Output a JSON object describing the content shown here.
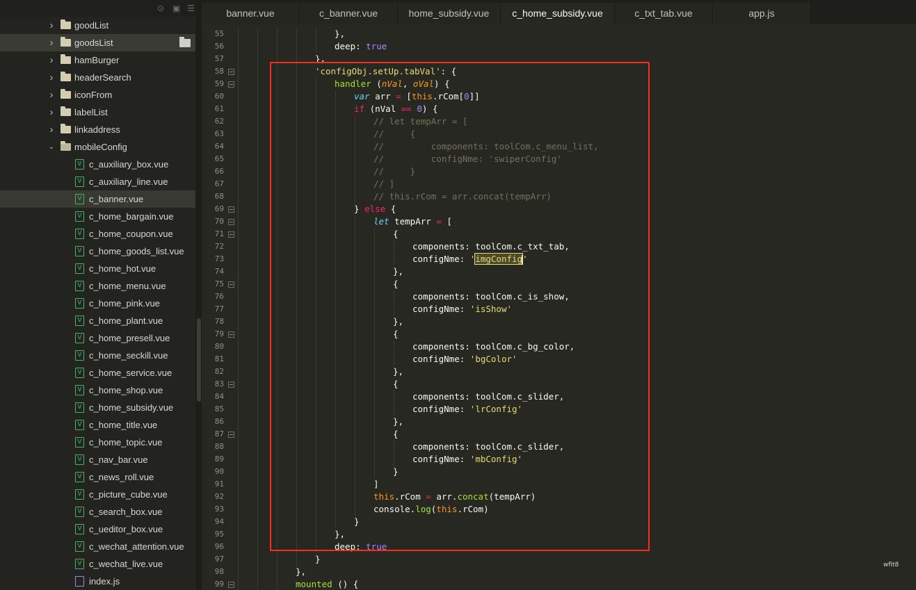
{
  "sidebar": {
    "items": [
      {
        "label": "goodList",
        "type": "folder",
        "level": 1,
        "expanded": false
      },
      {
        "label": "goodsList",
        "type": "folder",
        "level": 1,
        "expanded": false,
        "selected": true
      },
      {
        "label": "hamBurger",
        "type": "folder",
        "level": 1,
        "expanded": false
      },
      {
        "label": "headerSearch",
        "type": "folder",
        "level": 1,
        "expanded": false
      },
      {
        "label": "iconFrom",
        "type": "folder",
        "level": 1,
        "expanded": false
      },
      {
        "label": "labelList",
        "type": "folder",
        "level": 1,
        "expanded": false
      },
      {
        "label": "linkaddress",
        "type": "folder",
        "level": 1,
        "expanded": false
      },
      {
        "label": "mobileConfig",
        "type": "folder",
        "level": 1,
        "expanded": true
      },
      {
        "label": "c_auxiliary_box.vue",
        "type": "vue",
        "level": 2
      },
      {
        "label": "c_auxiliary_line.vue",
        "type": "vue",
        "level": 2
      },
      {
        "label": "c_banner.vue",
        "type": "vue",
        "level": 2,
        "active": true
      },
      {
        "label": "c_home_bargain.vue",
        "type": "vue",
        "level": 2
      },
      {
        "label": "c_home_coupon.vue",
        "type": "vue",
        "level": 2
      },
      {
        "label": "c_home_goods_list.vue",
        "type": "vue",
        "level": 2
      },
      {
        "label": "c_home_hot.vue",
        "type": "vue",
        "level": 2
      },
      {
        "label": "c_home_menu.vue",
        "type": "vue",
        "level": 2
      },
      {
        "label": "c_home_pink.vue",
        "type": "vue",
        "level": 2
      },
      {
        "label": "c_home_plant.vue",
        "type": "vue",
        "level": 2
      },
      {
        "label": "c_home_presell.vue",
        "type": "vue",
        "level": 2
      },
      {
        "label": "c_home_seckill.vue",
        "type": "vue",
        "level": 2
      },
      {
        "label": "c_home_service.vue",
        "type": "vue",
        "level": 2
      },
      {
        "label": "c_home_shop.vue",
        "type": "vue",
        "level": 2
      },
      {
        "label": "c_home_subsidy.vue",
        "type": "vue",
        "level": 2
      },
      {
        "label": "c_home_title.vue",
        "type": "vue",
        "level": 2
      },
      {
        "label": "c_home_topic.vue",
        "type": "vue",
        "level": 2
      },
      {
        "label": "c_nav_bar.vue",
        "type": "vue",
        "level": 2
      },
      {
        "label": "c_news_roll.vue",
        "type": "vue",
        "level": 2
      },
      {
        "label": "c_picture_cube.vue",
        "type": "vue",
        "level": 2
      },
      {
        "label": "c_search_box.vue",
        "type": "vue",
        "level": 2
      },
      {
        "label": "c_ueditor_box.vue",
        "type": "vue",
        "level": 2
      },
      {
        "label": "c_wechat_attention.vue",
        "type": "vue",
        "level": 2
      },
      {
        "label": "c_wechat_live.vue",
        "type": "vue",
        "level": 2
      },
      {
        "label": "index.js",
        "type": "js",
        "level": 2
      }
    ]
  },
  "tabs": [
    {
      "label": "banner.vue",
      "active": false
    },
    {
      "label": "c_banner.vue",
      "active": false
    },
    {
      "label": "home_subsidy.vue",
      "active": false
    },
    {
      "label": "c_home_subsidy.vue",
      "active": true
    },
    {
      "label": "c_txt_tab.vue",
      "active": false
    },
    {
      "label": "app.js",
      "active": false
    }
  ],
  "editor": {
    "lines": [
      {
        "n": "55",
        "fold": false,
        "indent": 5,
        "tokens": [
          [
            "p",
            "},"
          ]
        ]
      },
      {
        "n": "56",
        "fold": false,
        "indent": 5,
        "tokens": [
          [
            "p",
            "deep: "
          ],
          [
            "bool",
            "true"
          ]
        ]
      },
      {
        "n": "57",
        "fold": false,
        "indent": 4,
        "tokens": [
          [
            "p",
            "},"
          ]
        ]
      },
      {
        "n": "58",
        "fold": true,
        "indent": 4,
        "tokens": [
          [
            "str",
            "'configObj.setUp.tabVal'"
          ],
          [
            "p",
            ": {"
          ]
        ]
      },
      {
        "n": "59",
        "fold": true,
        "indent": 5,
        "tokens": [
          [
            "fn",
            "handler"
          ],
          [
            "p",
            " ("
          ],
          [
            "arg",
            "nVal"
          ],
          [
            "p",
            ", "
          ],
          [
            "arg",
            "oVal"
          ],
          [
            "p",
            ") {"
          ]
        ]
      },
      {
        "n": "60",
        "fold": false,
        "indent": 6,
        "tokens": [
          [
            "sto",
            "var"
          ],
          [
            "p",
            " arr "
          ],
          [
            "kw",
            "="
          ],
          [
            "p",
            " ["
          ],
          [
            "this",
            "this"
          ],
          [
            "p",
            ".rCom["
          ],
          [
            "num",
            "0"
          ],
          [
            "p",
            "]]"
          ]
        ]
      },
      {
        "n": "61",
        "fold": false,
        "indent": 6,
        "tokens": [
          [
            "kw",
            "if"
          ],
          [
            "p",
            " (nVal "
          ],
          [
            "kw",
            "=="
          ],
          [
            "p",
            " "
          ],
          [
            "num",
            "0"
          ],
          [
            "p",
            ") {"
          ]
        ]
      },
      {
        "n": "62",
        "fold": false,
        "indent": 7,
        "tokens": [
          [
            "cmt",
            "// let tempArr = ["
          ]
        ]
      },
      {
        "n": "63",
        "fold": false,
        "indent": 7,
        "tokens": [
          [
            "cmt",
            "//     {"
          ]
        ]
      },
      {
        "n": "64",
        "fold": false,
        "indent": 7,
        "tokens": [
          [
            "cmt",
            "//         components: toolCom.c_menu_list,"
          ]
        ]
      },
      {
        "n": "65",
        "fold": false,
        "indent": 7,
        "tokens": [
          [
            "cmt",
            "//         configNme: 'swiperConfig'"
          ]
        ]
      },
      {
        "n": "66",
        "fold": false,
        "indent": 7,
        "tokens": [
          [
            "cmt",
            "//     }"
          ]
        ]
      },
      {
        "n": "67",
        "fold": false,
        "indent": 7,
        "tokens": [
          [
            "cmt",
            "// ]"
          ]
        ]
      },
      {
        "n": "68",
        "fold": false,
        "indent": 7,
        "tokens": [
          [
            "cmt",
            "// this.rCom = arr.concat(tempArr)"
          ]
        ]
      },
      {
        "n": "69",
        "fold": true,
        "indent": 6,
        "tokens": [
          [
            "p",
            "} "
          ],
          [
            "kw",
            "else"
          ],
          [
            "p",
            " {"
          ]
        ]
      },
      {
        "n": "70",
        "fold": true,
        "indent": 7,
        "tokens": [
          [
            "sto",
            "let"
          ],
          [
            "p",
            " tempArr "
          ],
          [
            "kw",
            "="
          ],
          [
            "p",
            " ["
          ]
        ]
      },
      {
        "n": "71",
        "fold": true,
        "indent": 8,
        "tokens": [
          [
            "p",
            "{"
          ]
        ]
      },
      {
        "n": "72",
        "fold": false,
        "indent": 9,
        "tokens": [
          [
            "p",
            "components: toolCom.c_txt_tab,"
          ]
        ]
      },
      {
        "n": "73",
        "fold": false,
        "indent": 9,
        "tokens": [
          [
            "p",
            "configNme: "
          ],
          [
            "str",
            "'"
          ],
          [
            "hl",
            "imgConfig"
          ],
          [
            "caret",
            ""
          ],
          [
            "str",
            "'"
          ]
        ]
      },
      {
        "n": "74",
        "fold": false,
        "indent": 8,
        "tokens": [
          [
            "p",
            "},"
          ]
        ]
      },
      {
        "n": "75",
        "fold": true,
        "indent": 8,
        "tokens": [
          [
            "p",
            "{"
          ]
        ]
      },
      {
        "n": "76",
        "fold": false,
        "indent": 9,
        "tokens": [
          [
            "p",
            "components: toolCom.c_is_show,"
          ]
        ]
      },
      {
        "n": "77",
        "fold": false,
        "indent": 9,
        "tokens": [
          [
            "p",
            "configNme: "
          ],
          [
            "str",
            "'isShow'"
          ]
        ]
      },
      {
        "n": "78",
        "fold": false,
        "indent": 8,
        "tokens": [
          [
            "p",
            "},"
          ]
        ]
      },
      {
        "n": "79",
        "fold": true,
        "indent": 8,
        "tokens": [
          [
            "p",
            "{"
          ]
        ]
      },
      {
        "n": "80",
        "fold": false,
        "indent": 9,
        "tokens": [
          [
            "p",
            "components: toolCom.c_bg_color,"
          ]
        ]
      },
      {
        "n": "81",
        "fold": false,
        "indent": 9,
        "tokens": [
          [
            "p",
            "configNme: "
          ],
          [
            "str",
            "'bgColor'"
          ]
        ]
      },
      {
        "n": "82",
        "fold": false,
        "indent": 8,
        "tokens": [
          [
            "p",
            "},"
          ]
        ]
      },
      {
        "n": "83",
        "fold": true,
        "indent": 8,
        "tokens": [
          [
            "p",
            "{"
          ]
        ]
      },
      {
        "n": "84",
        "fold": false,
        "indent": 9,
        "tokens": [
          [
            "p",
            "components: toolCom.c_slider,"
          ]
        ]
      },
      {
        "n": "85",
        "fold": false,
        "indent": 9,
        "tokens": [
          [
            "p",
            "configNme: "
          ],
          [
            "str",
            "'lrConfig'"
          ]
        ]
      },
      {
        "n": "86",
        "fold": false,
        "indent": 8,
        "tokens": [
          [
            "p",
            "},"
          ]
        ]
      },
      {
        "n": "87",
        "fold": true,
        "indent": 8,
        "tokens": [
          [
            "p",
            "{"
          ]
        ]
      },
      {
        "n": "88",
        "fold": false,
        "indent": 9,
        "tokens": [
          [
            "p",
            "components: toolCom.c_slider,"
          ]
        ]
      },
      {
        "n": "89",
        "fold": false,
        "indent": 9,
        "tokens": [
          [
            "p",
            "configNme: "
          ],
          [
            "str",
            "'mbConfig'"
          ]
        ]
      },
      {
        "n": "90",
        "fold": false,
        "indent": 8,
        "tokens": [
          [
            "p",
            "}"
          ]
        ]
      },
      {
        "n": "91",
        "fold": false,
        "indent": 7,
        "tokens": [
          [
            "p",
            "]"
          ]
        ]
      },
      {
        "n": "92",
        "fold": false,
        "indent": 7,
        "tokens": [
          [
            "this",
            "this"
          ],
          [
            "p",
            ".rCom "
          ],
          [
            "kw",
            "="
          ],
          [
            "p",
            " arr."
          ],
          [
            "fn",
            "concat"
          ],
          [
            "p",
            "(tempArr)"
          ]
        ]
      },
      {
        "n": "93",
        "fold": false,
        "indent": 7,
        "tokens": [
          [
            "p",
            "console."
          ],
          [
            "fn",
            "log"
          ],
          [
            "p",
            "("
          ],
          [
            "this",
            "this"
          ],
          [
            "p",
            ".rCom)"
          ]
        ]
      },
      {
        "n": "94",
        "fold": false,
        "indent": 6,
        "tokens": [
          [
            "p",
            "}"
          ]
        ]
      },
      {
        "n": "95",
        "fold": false,
        "indent": 5,
        "tokens": [
          [
            "p",
            "},"
          ]
        ]
      },
      {
        "n": "96",
        "fold": false,
        "indent": 5,
        "tokens": [
          [
            "p",
            "deep: "
          ],
          [
            "bool",
            "true"
          ]
        ]
      },
      {
        "n": "97",
        "fold": false,
        "indent": 4,
        "tokens": [
          [
            "p",
            "}"
          ]
        ]
      },
      {
        "n": "98",
        "fold": false,
        "indent": 3,
        "tokens": [
          [
            "p",
            "},"
          ]
        ]
      },
      {
        "n": "99",
        "fold": true,
        "indent": 3,
        "tokens": [
          [
            "fn",
            "mounted"
          ],
          [
            "p",
            " () {"
          ]
        ]
      }
    ]
  },
  "colors": {
    "annotation_box": "#ff2a1f",
    "editor_bg": "#272822",
    "sidebar_bg": "#23241f"
  },
  "watermark": "wfit8"
}
